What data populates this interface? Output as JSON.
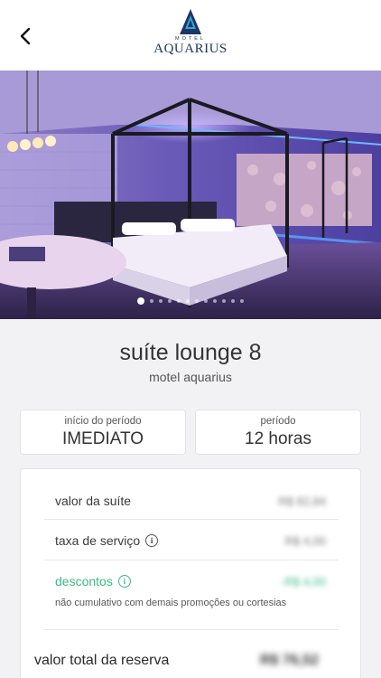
{
  "header": {
    "back_icon": "chevron-left-icon",
    "logo_top": "MOTEL",
    "logo_name": "AQUARIUS"
  },
  "gallery": {
    "slide_count": 12,
    "active_index": 0
  },
  "suite": {
    "title": "suíte lounge 8",
    "motel": "motel aquarius"
  },
  "period": {
    "start_label": "início do período",
    "start_value": "IMEDIATO",
    "duration_label": "período",
    "duration_value": "12 horas"
  },
  "pricing": {
    "suite_label": "valor da suíte",
    "suite_value": "R$ 82,84",
    "service_label": "taxa de serviço",
    "service_value": "R$ 4,00",
    "discount_label": "descontos",
    "discount_value": "-R$ 4,00",
    "discount_note": "não cumulativo com demais promoções ou cortesias",
    "total_label": "valor total da reserva",
    "total_value": "R$ 76,52"
  },
  "colors": {
    "brand": "#1c3566",
    "discount": "#3bb98a"
  }
}
